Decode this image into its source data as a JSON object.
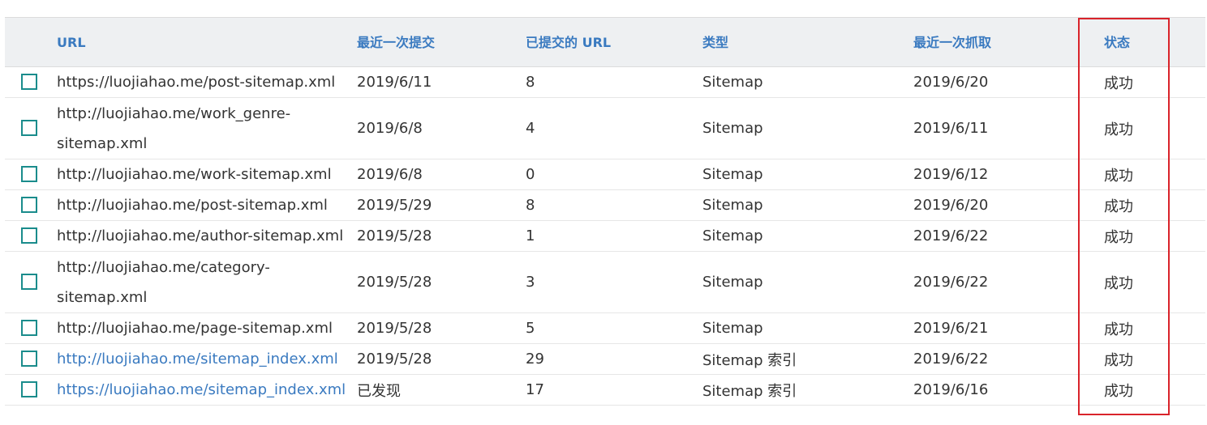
{
  "columns": {
    "url": "URL",
    "submitted": "最近一次提交",
    "submitted_urls": "已提交的 URL",
    "type": "类型",
    "last_crawled": "最近一次抓取",
    "status": "状态"
  },
  "accent_color": "#3a7ac0",
  "highlight_color": "#d9232a",
  "rows": [
    {
      "url": "https://luojiahao.me/post-sitemap.xml",
      "submitted": "2019/6/11",
      "count": "8",
      "type": "Sitemap",
      "last_crawled": "2019/6/20",
      "status": "成功",
      "link": false,
      "double": false
    },
    {
      "url": "http://luojiahao.me/work_genre-sitemap.xml",
      "submitted": "2019/6/8",
      "count": "4",
      "type": "Sitemap",
      "last_crawled": "2019/6/11",
      "status": "成功",
      "link": false,
      "double": true
    },
    {
      "url": "http://luojiahao.me/work-sitemap.xml",
      "submitted": "2019/6/8",
      "count": "0",
      "type": "Sitemap",
      "last_crawled": "2019/6/12",
      "status": "成功",
      "link": false,
      "double": false
    },
    {
      "url": "http://luojiahao.me/post-sitemap.xml",
      "submitted": "2019/5/29",
      "count": "8",
      "type": "Sitemap",
      "last_crawled": "2019/6/20",
      "status": "成功",
      "link": false,
      "double": false
    },
    {
      "url": "http://luojiahao.me/author-sitemap.xml",
      "submitted": "2019/5/28",
      "count": "1",
      "type": "Sitemap",
      "last_crawled": "2019/6/22",
      "status": "成功",
      "link": false,
      "double": false
    },
    {
      "url": "http://luojiahao.me/category-sitemap.xml",
      "submitted": "2019/5/28",
      "count": "3",
      "type": "Sitemap",
      "last_crawled": "2019/6/22",
      "status": "成功",
      "link": false,
      "double": true
    },
    {
      "url": "http://luojiahao.me/page-sitemap.xml",
      "submitted": "2019/5/28",
      "count": "5",
      "type": "Sitemap",
      "last_crawled": "2019/6/21",
      "status": "成功",
      "link": false,
      "double": false
    },
    {
      "url": "http://luojiahao.me/sitemap_index.xml",
      "submitted": "2019/5/28",
      "count": "29",
      "type": "Sitemap 索引",
      "last_crawled": "2019/6/22",
      "status": "成功",
      "link": true,
      "double": false
    },
    {
      "url": "https://luojiahao.me/sitemap_index.xml",
      "submitted": "已发现",
      "count": "17",
      "type": "Sitemap 索引",
      "last_crawled": "2019/6/16",
      "status": "成功",
      "link": true,
      "double": false
    }
  ]
}
